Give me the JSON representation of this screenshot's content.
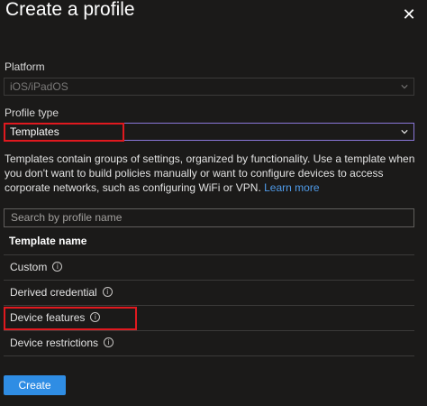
{
  "header": {
    "title": "Create a profile",
    "close_icon": "close-icon"
  },
  "platform": {
    "label": "Platform",
    "value": "iOS/iPadOS"
  },
  "profile_type": {
    "label": "Profile type",
    "value": "Templates"
  },
  "description": {
    "text": "Templates contain groups of settings, organized by functionality. Use a template when you don't want to build policies manually or want to configure devices to access corporate networks, such as configuring WiFi or VPN.",
    "link": "Learn more"
  },
  "search": {
    "placeholder": "Search by profile name"
  },
  "table": {
    "header": "Template name",
    "rows": [
      {
        "label": "Custom"
      },
      {
        "label": "Derived credential"
      },
      {
        "label": "Device features"
      },
      {
        "label": "Device restrictions"
      }
    ]
  },
  "footer": {
    "create_label": "Create"
  },
  "colors": {
    "background": "#1b1a19",
    "accent": "#2f8de4",
    "highlight": "#e0191f",
    "focus_border": "#8a77d8",
    "link": "#4f9ae8"
  }
}
